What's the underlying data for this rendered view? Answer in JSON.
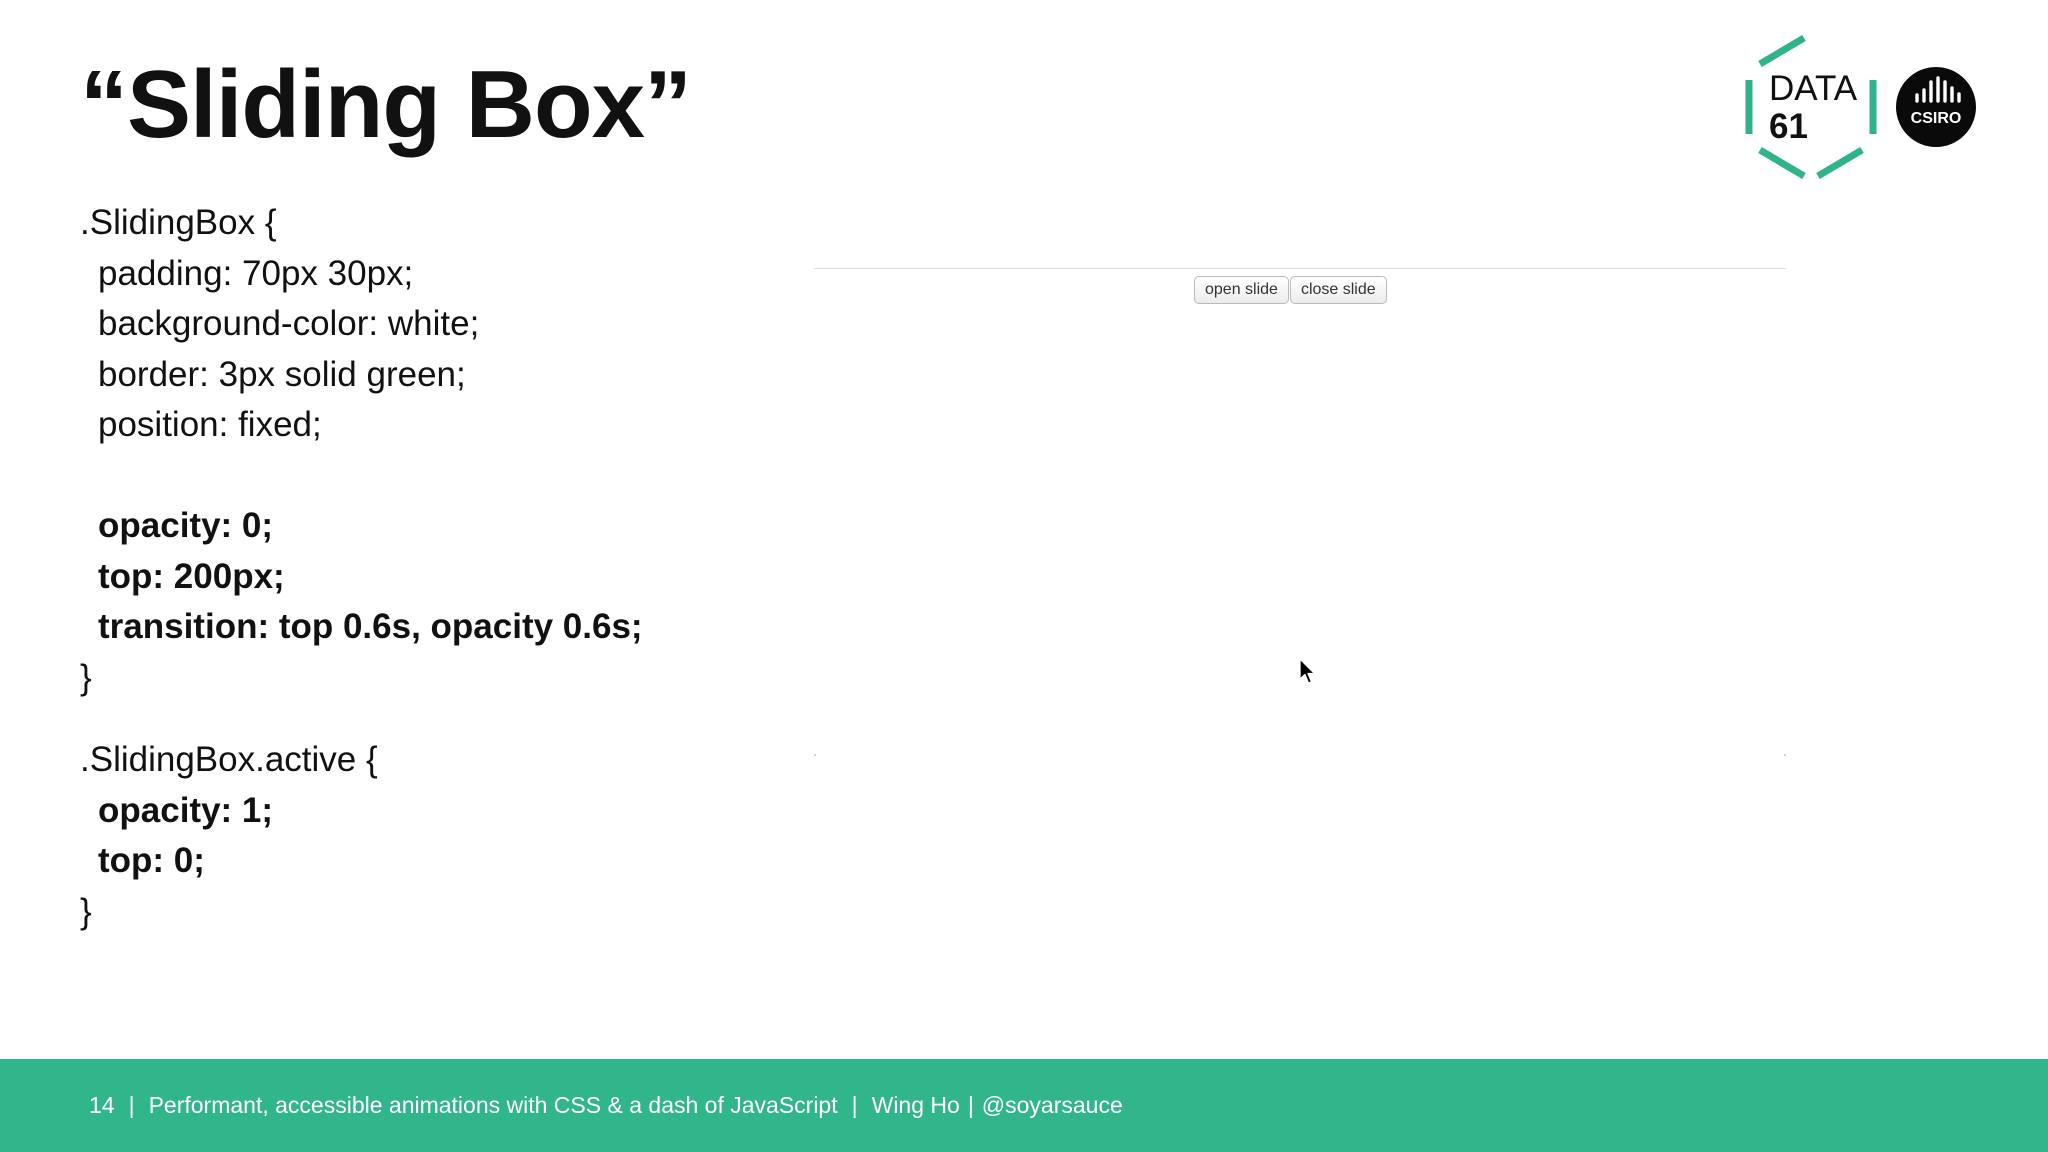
{
  "slide": {
    "title": "“Sliding Box”"
  },
  "code": {
    "lines": [
      {
        "text": ".SlidingBox {",
        "bold": false,
        "indent": false
      },
      {
        "text": "padding: 70px 30px;",
        "bold": false,
        "indent": true
      },
      {
        "text": "background-color: white;",
        "bold": false,
        "indent": true
      },
      {
        "text": "border: 3px solid green;",
        "bold": false,
        "indent": true
      },
      {
        "text": "position: fixed;",
        "bold": false,
        "indent": true
      },
      {
        "text": "",
        "bold": false,
        "indent": true
      },
      {
        "text": "opacity: 0;",
        "bold": true,
        "indent": true
      },
      {
        "text": "top: 200px;",
        "bold": true,
        "indent": true
      },
      {
        "text": "transition: top 0.6s, opacity 0.6s;",
        "bold": true,
        "indent": true
      },
      {
        "text": "}",
        "bold": false,
        "indent": false
      },
      {
        "text": "",
        "gap": true
      },
      {
        "text": ".SlidingBox.active {",
        "bold": false,
        "indent": false
      },
      {
        "text": "opacity: 1;",
        "bold": true,
        "indent": true
      },
      {
        "text": "top: 0;",
        "bold": true,
        "indent": true
      },
      {
        "text": "}",
        "bold": false,
        "indent": false
      }
    ]
  },
  "demo": {
    "open_label": "open slide",
    "close_label": "close slide"
  },
  "logos": {
    "data61_line1": "DATA",
    "data61_line2": "61",
    "csiro": "CSIRO"
  },
  "footer": {
    "page_number": "14",
    "talk_title": "Performant, accessible animations with CSS & a dash of JavaScript",
    "author": "Wing Ho",
    "handle": "@soyarsauce"
  },
  "colors": {
    "accent": "#31b58a",
    "logo_green": "#2fb38a",
    "text": "#111111"
  }
}
